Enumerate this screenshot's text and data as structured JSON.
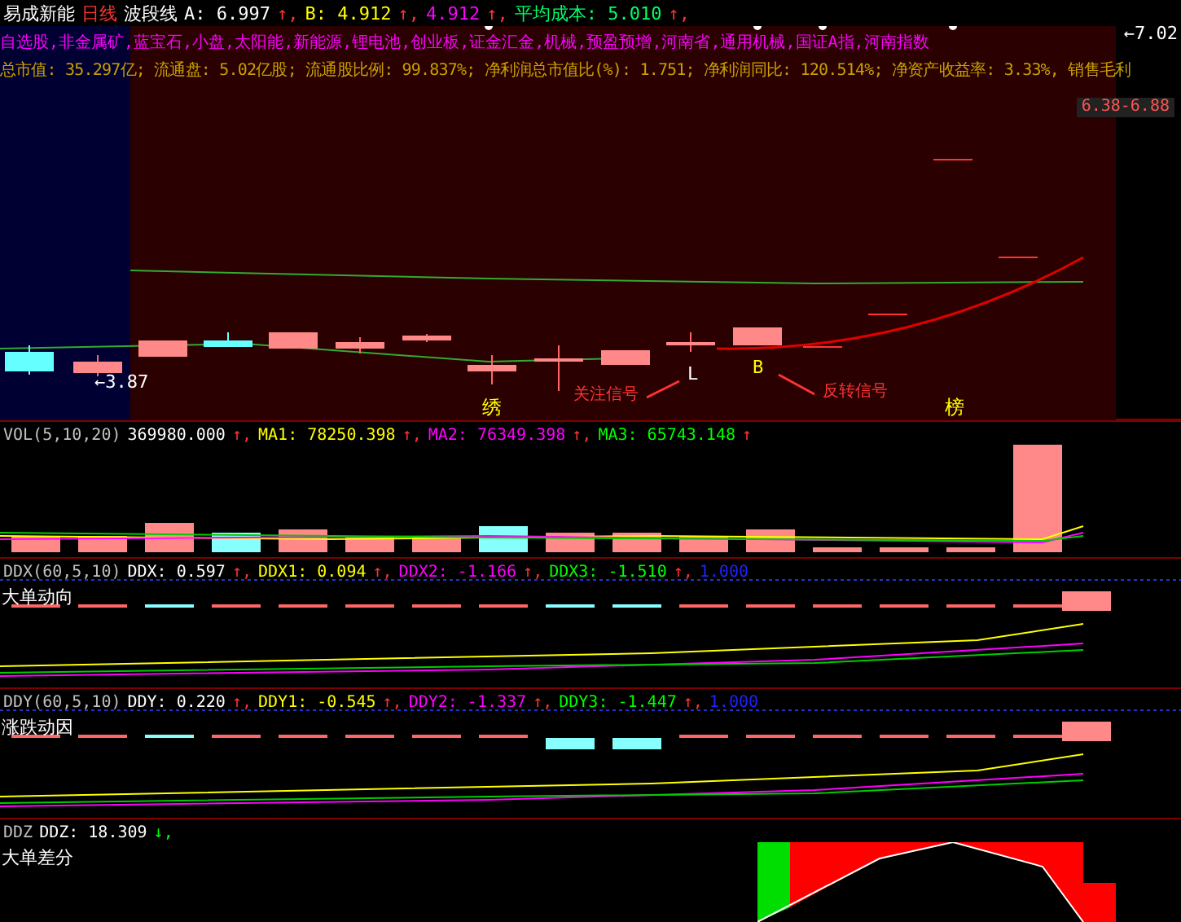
{
  "header": {
    "segments": [
      {
        "text": "易成新能",
        "color": "#ffffff"
      },
      {
        "text": "日线",
        "color": "#ff3333"
      },
      {
        "text": "波段线",
        "color": "#ffffff"
      },
      {
        "text": "A: 6.997",
        "color": "#ffffff"
      },
      {
        "text": "↑,",
        "color": "#ff3333"
      },
      {
        "text": "B: 4.912",
        "color": "#ffff00"
      },
      {
        "text": "↑,",
        "color": "#ff3333"
      },
      {
        "text": "4.912",
        "color": "#ff00ff"
      },
      {
        "text": "↑,",
        "color": "#ff3333"
      },
      {
        "text": "平均成本: 5.010",
        "color": "#00ff66"
      },
      {
        "text": "↑,",
        "color": "#ff3333"
      }
    ]
  },
  "concepts": "自选股,非金属矿,蓝宝石,小盘,太阳能,新能源,锂电池,创业板,证金汇金,机械,预盈预增,河南省,通用机械,国证A指,河南指数",
  "financials": "总市值: 35.297亿; 流通盘: 5.02亿股; 流通股比例: 99.837%; 净利润总市值比(%): 1.751; 净利润同比: 120.514%; 净资产收益率: 3.33%, 销售毛利",
  "price_labels": {
    "high": "←7.02",
    "low": "←3.87",
    "range": "6.38-6.88"
  },
  "signals": [
    {
      "text": "L",
      "color": "#ffffff"
    },
    {
      "text": "B",
      "color": "#ffff00"
    }
  ],
  "callouts": [
    "关注信号",
    "反转信号"
  ],
  "markers": [
    "绣",
    "榜"
  ],
  "panels": [
    {
      "kind": "vol",
      "segments": [
        {
          "text": "VOL(5,10,20)",
          "color": "#c0c0c0"
        },
        {
          "text": "369980.000",
          "color": "#ffffff"
        },
        {
          "text": "↑,",
          "color": "#ff3333"
        },
        {
          "text": "MA1: 78250.398",
          "color": "#ffff00"
        },
        {
          "text": "↑,",
          "color": "#ff3333"
        },
        {
          "text": "MA2: 76349.398",
          "color": "#ff00ff"
        },
        {
          "text": "↑,",
          "color": "#ff3333"
        },
        {
          "text": "MA3: 65743.148",
          "color": "#00ff00"
        },
        {
          "text": "↑",
          "color": "#ff3333"
        }
      ]
    },
    {
      "kind": "ddx",
      "title": "大单动向",
      "segments": [
        {
          "text": "DDX(60,5,10)",
          "color": "#c0c0c0"
        },
        {
          "text": "DDX: 0.597",
          "color": "#ffffff"
        },
        {
          "text": "↑,",
          "color": "#ff3333"
        },
        {
          "text": "DDX1: 0.094",
          "color": "#ffff00"
        },
        {
          "text": "↑,",
          "color": "#ff3333"
        },
        {
          "text": "DDX2: -1.166",
          "color": "#ff00ff"
        },
        {
          "text": "↑,",
          "color": "#ff3333"
        },
        {
          "text": "DDX3: -1.510",
          "color": "#00ff00"
        },
        {
          "text": "↑,",
          "color": "#ff3333"
        },
        {
          "text": "1.000",
          "color": "#2222ff"
        }
      ]
    },
    {
      "kind": "ddy",
      "title": "涨跌动因",
      "segments": [
        {
          "text": "DDY(60,5,10)",
          "color": "#c0c0c0"
        },
        {
          "text": "DDY: 0.220",
          "color": "#ffffff"
        },
        {
          "text": "↑,",
          "color": "#ff3333"
        },
        {
          "text": "DDY1: -0.545",
          "color": "#ffff00"
        },
        {
          "text": "↑,",
          "color": "#ff3333"
        },
        {
          "text": "DDY2: -1.337",
          "color": "#ff00ff"
        },
        {
          "text": "↑,",
          "color": "#ff3333"
        },
        {
          "text": "DDY3: -1.447",
          "color": "#00ff00"
        },
        {
          "text": "↑,",
          "color": "#ff3333"
        },
        {
          "text": "1.000",
          "color": "#2222ff"
        }
      ]
    },
    {
      "kind": "ddz",
      "title": "大单差分",
      "segments": [
        {
          "text": "DDZ",
          "color": "#c0c0c0"
        },
        {
          "text": "DDZ: 18.309",
          "color": "#ffffff"
        },
        {
          "text": "↓,",
          "color": "#00ff00"
        }
      ]
    }
  ]
}
